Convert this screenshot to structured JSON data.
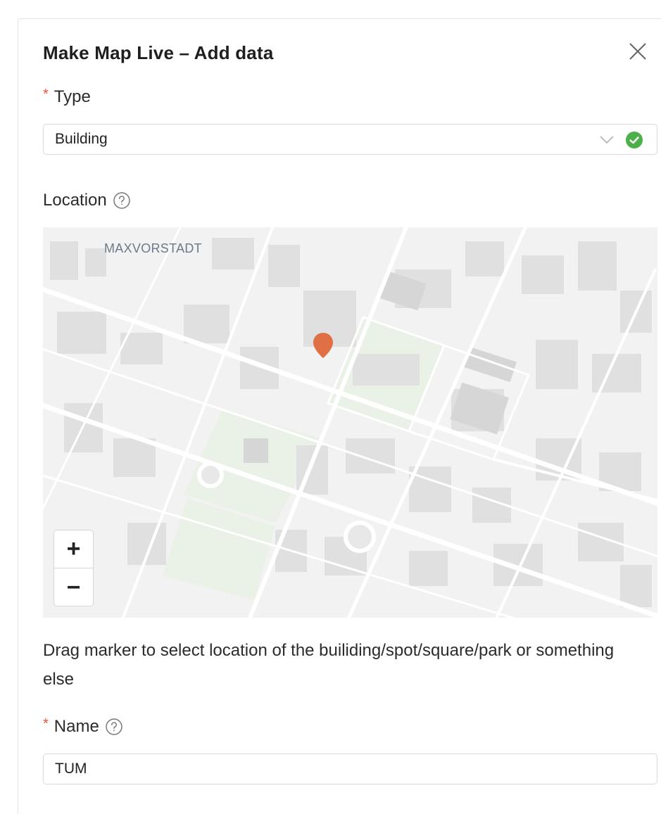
{
  "dialog": {
    "title": "Make Map Live – Add data",
    "required_marker": "*"
  },
  "type_field": {
    "label": "Type",
    "selected": "Building",
    "valid": true
  },
  "location_field": {
    "label": "Location",
    "district_label": "MAXVORSTADT",
    "zoom_in_label": "+",
    "zoom_out_label": "−",
    "hint": "Drag marker to select location of the builiding/spot/square/park or something else"
  },
  "name_field": {
    "label": "Name",
    "value": "TUM"
  },
  "colors": {
    "accent_success": "#4cb04a",
    "required": "#e2553a",
    "marker": "#e07044",
    "park": "#eaf1e6"
  },
  "icons": {
    "close": "close-icon",
    "help": "question-circle-icon",
    "chevron": "chevron-down-icon",
    "check": "check-circle-icon",
    "marker": "map-marker-icon"
  }
}
